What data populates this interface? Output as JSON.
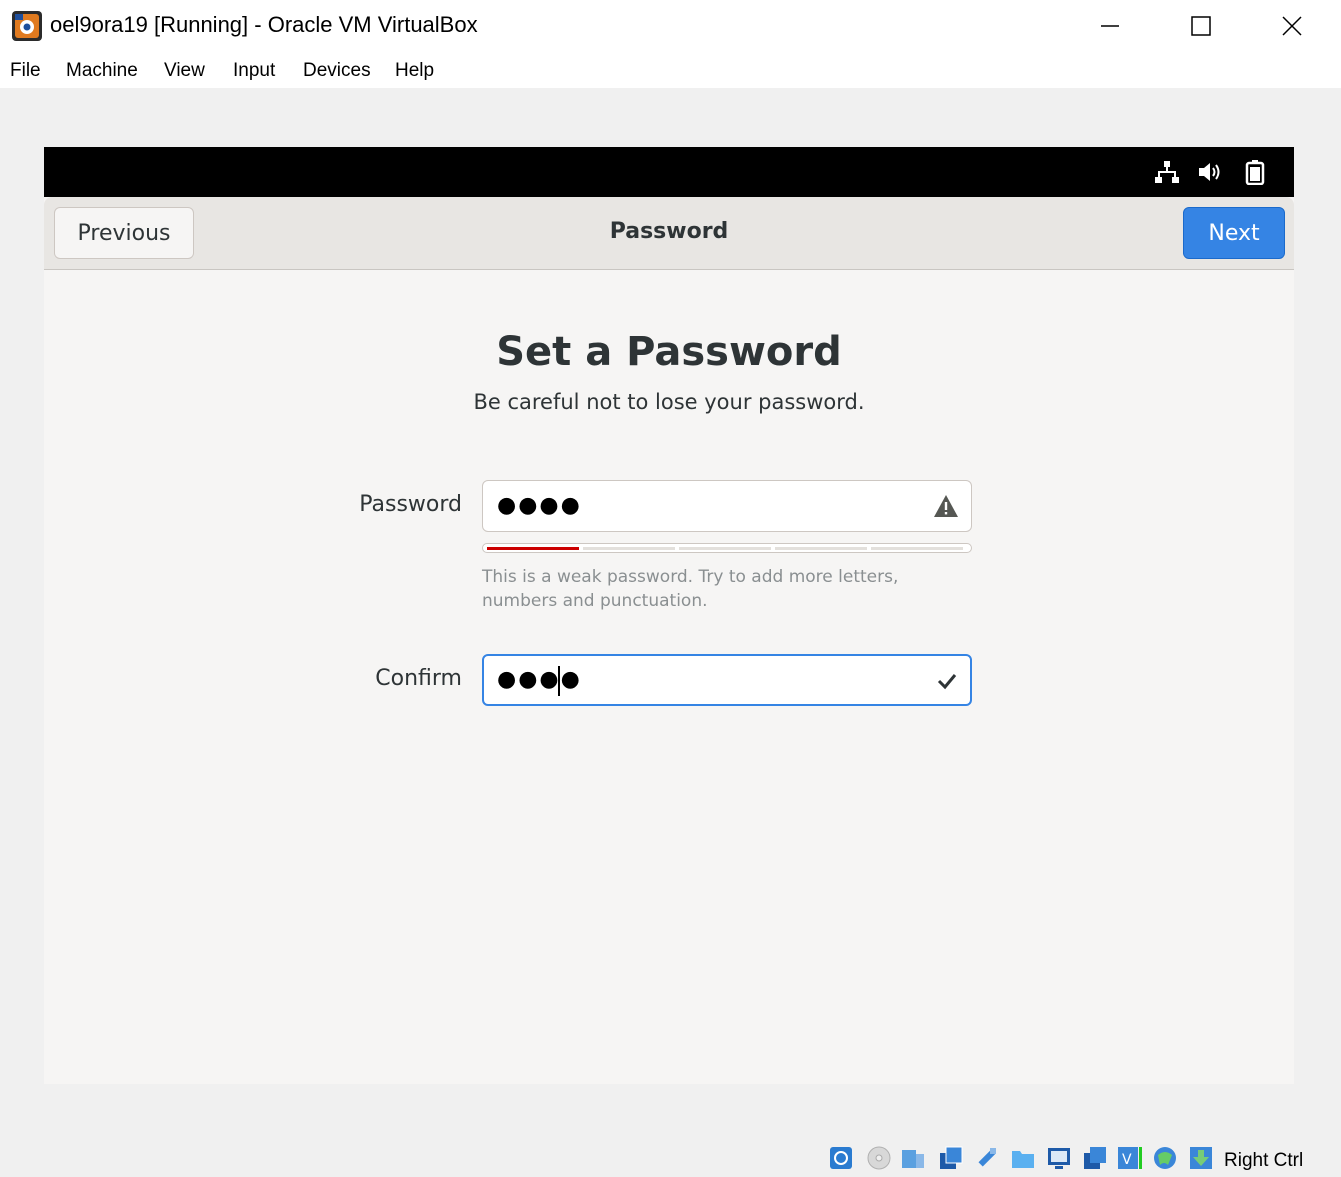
{
  "window": {
    "title": "oel9ora19 [Running] - Oracle VM VirtualBox",
    "icon": "virtualbox-icon",
    "controls": [
      "minimize-icon",
      "maximize-icon",
      "close-icon"
    ]
  },
  "menubar": {
    "items": [
      "File",
      "Machine",
      "View",
      "Input",
      "Devices",
      "Help"
    ]
  },
  "vm": {
    "tray_icons": [
      "network-icon",
      "volume-icon",
      "battery-icon"
    ],
    "header": {
      "previous_label": "Previous",
      "title": "Password",
      "next_label": "Next"
    },
    "page": {
      "heading": "Set a Password",
      "subtitle": "Be careful not to lose your password."
    },
    "password_field": {
      "label": "Password",
      "value": "●●●●",
      "status_icon": "warning-icon"
    },
    "strength": {
      "level": 0.2,
      "fill_color": "#cc0000",
      "hint": "This is a weak password. Try to add more letters, numbers and punctuation."
    },
    "confirm_field": {
      "label": "Confirm",
      "value": "●●●●",
      "status_icon": "checkmark-icon"
    },
    "accent_color": "#3584e4"
  },
  "statusbar": {
    "icons": [
      "hard-disk-icon",
      "optical-drive-icon",
      "audio-icon",
      "network-adapter-icon",
      "usb-icon",
      "shared-folders-icon",
      "display-icon",
      "recording-icon",
      "virtualization-icon",
      "mouse-integration-icon",
      "guest-additions-icon"
    ],
    "host_key": "Right Ctrl"
  }
}
